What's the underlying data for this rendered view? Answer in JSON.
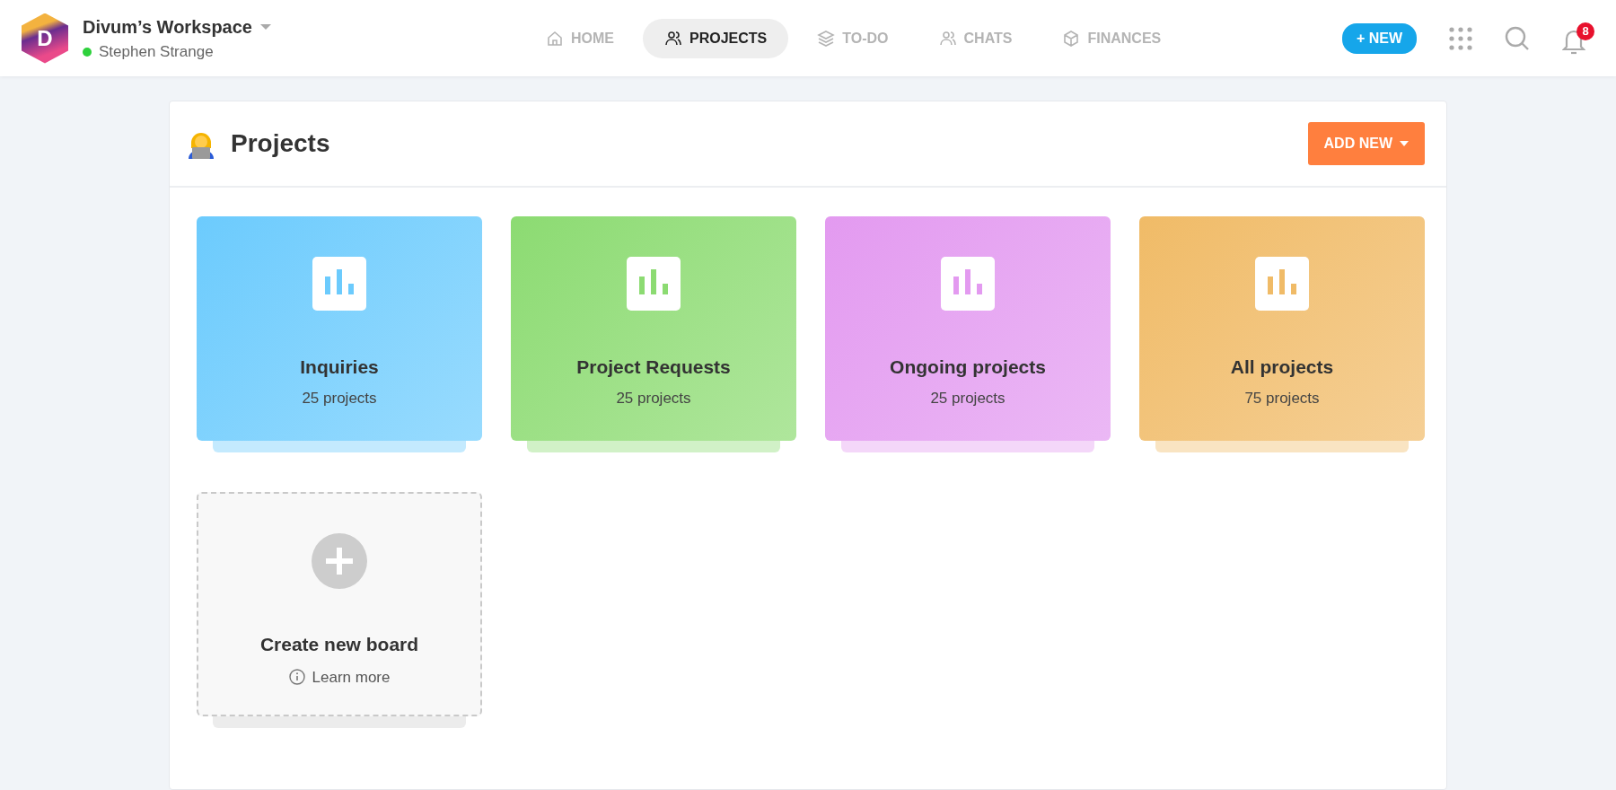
{
  "workspace": {
    "logo_letter": "D",
    "name": "Divum’s Workspace",
    "user": "Stephen Strange",
    "online": true
  },
  "nav": [
    {
      "label": "HOME",
      "selected": false
    },
    {
      "label": "PROJECTS",
      "selected": true
    },
    {
      "label": "TO-DO",
      "selected": false
    },
    {
      "label": "CHATS",
      "selected": false
    },
    {
      "label": "FINANCES",
      "selected": false
    }
  ],
  "new_button": "+ NEW",
  "notifications": {
    "count": "8"
  },
  "page": {
    "title": "Projects",
    "add_button": "ADD NEW"
  },
  "boards": [
    {
      "title": "Inquiries",
      "count": "25 projects",
      "color": "#6ccbfd"
    },
    {
      "title": "Project Requests",
      "count": "25 projects",
      "color": "#8cdb72"
    },
    {
      "title": "Ongoing projects",
      "count": "25 projects",
      "color": "#e39af0"
    },
    {
      "title": "All projects",
      "count": "75 projects",
      "color": "#f0bb67"
    }
  ],
  "create_board": {
    "title": "Create new board",
    "link": "Learn more"
  }
}
